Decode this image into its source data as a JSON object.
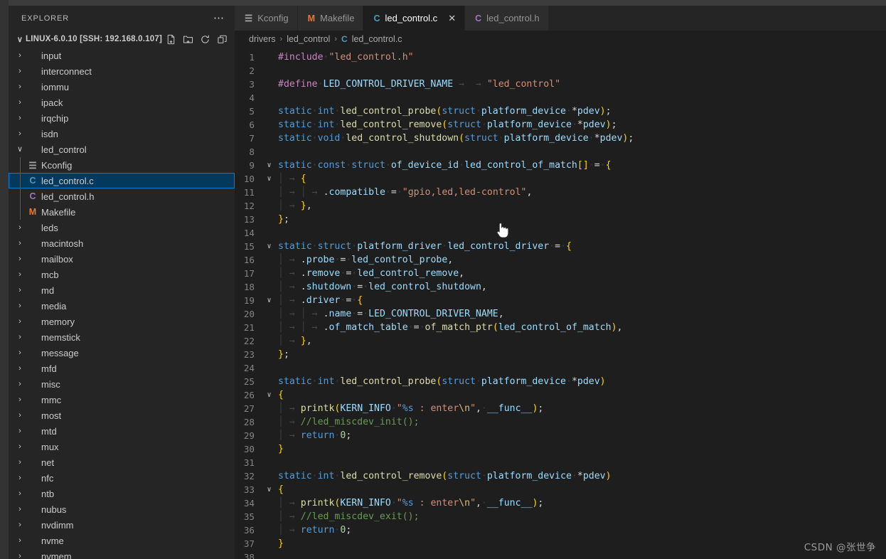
{
  "window": {
    "titlebar_color": "#3c3c3c",
    "sidebar_color": "#252526",
    "editor_color": "#1e1e1e",
    "accent_color": "#007fd4",
    "selection_color": "#04395e"
  },
  "sidebar": {
    "title": "EXPLORER",
    "more_actions": "⋯",
    "root": {
      "chevron": "∨",
      "name": "LINUX-6.0.10 [SSH: 192.168.0.107]",
      "actions": [
        {
          "name": "new-file",
          "tooltip": "New File"
        },
        {
          "name": "new-folder",
          "tooltip": "New Folder"
        },
        {
          "name": "refresh-explorer",
          "tooltip": "Refresh Explorer"
        },
        {
          "name": "collapse-folders",
          "tooltip": "Collapse Folders in Explorer"
        }
      ]
    },
    "tree": [
      {
        "label": "input",
        "type": "folder",
        "expanded": false,
        "depth": 1,
        "arrow": "›"
      },
      {
        "label": "interconnect",
        "type": "folder",
        "expanded": false,
        "depth": 1,
        "arrow": "›"
      },
      {
        "label": "iommu",
        "type": "folder",
        "expanded": false,
        "depth": 1,
        "arrow": "›"
      },
      {
        "label": "ipack",
        "type": "folder",
        "expanded": false,
        "depth": 1,
        "arrow": "›"
      },
      {
        "label": "irqchip",
        "type": "folder",
        "expanded": false,
        "depth": 1,
        "arrow": "›"
      },
      {
        "label": "isdn",
        "type": "folder",
        "expanded": false,
        "depth": 1,
        "arrow": "›"
      },
      {
        "label": "led_control",
        "type": "folder",
        "expanded": true,
        "depth": 1,
        "arrow": "∨"
      },
      {
        "label": "Kconfig",
        "type": "file",
        "icon": "kconfig-icon",
        "glyph": "☰",
        "iconclass": "ic-k",
        "depth": 2,
        "selected": false
      },
      {
        "label": "led_control.c",
        "type": "file",
        "icon": "c-file-icon",
        "glyph": "C",
        "iconclass": "ic-c",
        "depth": 2,
        "selected": true
      },
      {
        "label": "led_control.h",
        "type": "file",
        "icon": "h-file-icon",
        "glyph": "C",
        "iconclass": "ic-h",
        "depth": 2,
        "selected": false
      },
      {
        "label": "Makefile",
        "type": "file",
        "icon": "makefile-icon",
        "glyph": "M",
        "iconclass": "ic-m",
        "depth": 2,
        "selected": false
      },
      {
        "label": "leds",
        "type": "folder",
        "expanded": false,
        "depth": 1,
        "arrow": "›"
      },
      {
        "label": "macintosh",
        "type": "folder",
        "expanded": false,
        "depth": 1,
        "arrow": "›"
      },
      {
        "label": "mailbox",
        "type": "folder",
        "expanded": false,
        "depth": 1,
        "arrow": "›"
      },
      {
        "label": "mcb",
        "type": "folder",
        "expanded": false,
        "depth": 1,
        "arrow": "›"
      },
      {
        "label": "md",
        "type": "folder",
        "expanded": false,
        "depth": 1,
        "arrow": "›"
      },
      {
        "label": "media",
        "type": "folder",
        "expanded": false,
        "depth": 1,
        "arrow": "›"
      },
      {
        "label": "memory",
        "type": "folder",
        "expanded": false,
        "depth": 1,
        "arrow": "›"
      },
      {
        "label": "memstick",
        "type": "folder",
        "expanded": false,
        "depth": 1,
        "arrow": "›"
      },
      {
        "label": "message",
        "type": "folder",
        "expanded": false,
        "depth": 1,
        "arrow": "›"
      },
      {
        "label": "mfd",
        "type": "folder",
        "expanded": false,
        "depth": 1,
        "arrow": "›"
      },
      {
        "label": "misc",
        "type": "folder",
        "expanded": false,
        "depth": 1,
        "arrow": "›"
      },
      {
        "label": "mmc",
        "type": "folder",
        "expanded": false,
        "depth": 1,
        "arrow": "›"
      },
      {
        "label": "most",
        "type": "folder",
        "expanded": false,
        "depth": 1,
        "arrow": "›"
      },
      {
        "label": "mtd",
        "type": "folder",
        "expanded": false,
        "depth": 1,
        "arrow": "›"
      },
      {
        "label": "mux",
        "type": "folder",
        "expanded": false,
        "depth": 1,
        "arrow": "›"
      },
      {
        "label": "net",
        "type": "folder",
        "expanded": false,
        "depth": 1,
        "arrow": "›"
      },
      {
        "label": "nfc",
        "type": "folder",
        "expanded": false,
        "depth": 1,
        "arrow": "›"
      },
      {
        "label": "ntb",
        "type": "folder",
        "expanded": false,
        "depth": 1,
        "arrow": "›"
      },
      {
        "label": "nubus",
        "type": "folder",
        "expanded": false,
        "depth": 1,
        "arrow": "›"
      },
      {
        "label": "nvdimm",
        "type": "folder",
        "expanded": false,
        "depth": 1,
        "arrow": "›"
      },
      {
        "label": "nvme",
        "type": "folder",
        "expanded": false,
        "depth": 1,
        "arrow": "›"
      },
      {
        "label": "nvmem",
        "type": "folder",
        "expanded": false,
        "depth": 1,
        "arrow": "›"
      }
    ]
  },
  "tabs": [
    {
      "label": "Kconfig",
      "icon": "kconfig-icon",
      "glyph": "☰",
      "iconclass": "ic-k",
      "active": false,
      "closable": false
    },
    {
      "label": "Makefile",
      "icon": "makefile-icon",
      "glyph": "M",
      "iconclass": "ic-m",
      "active": false,
      "closable": false
    },
    {
      "label": "led_control.c",
      "icon": "c-file-icon",
      "glyph": "C",
      "iconclass": "ic-c",
      "active": true,
      "closable": true,
      "close_glyph": "✕"
    },
    {
      "label": "led_control.h",
      "icon": "h-file-icon",
      "glyph": "C",
      "iconclass": "ic-h",
      "active": false,
      "closable": false
    }
  ],
  "breadcrumb": {
    "items": [
      "drivers",
      "led_control",
      "led_control.c"
    ],
    "separator": "›",
    "file_icon_glyph": "C"
  },
  "editor": {
    "language": "c",
    "first_line": 1,
    "last_line": 38,
    "lines": [
      {
        "n": 1,
        "fold": "",
        "text": "#include \"led_control.h\""
      },
      {
        "n": 2,
        "fold": "",
        "text": ""
      },
      {
        "n": 3,
        "fold": "",
        "text": "#define LED_CONTROL_DRIVER_NAME\t\t\"led_control\""
      },
      {
        "n": 4,
        "fold": "",
        "text": ""
      },
      {
        "n": 5,
        "fold": "",
        "text": "static int led_control_probe(struct platform_device *pdev);"
      },
      {
        "n": 6,
        "fold": "",
        "text": "static int led_control_remove(struct platform_device *pdev);"
      },
      {
        "n": 7,
        "fold": "",
        "text": "static void led_control_shutdown(struct platform_device *pdev);"
      },
      {
        "n": 8,
        "fold": "",
        "text": ""
      },
      {
        "n": 9,
        "fold": "v",
        "text": "static const struct of_device_id led_control_of_match[] = {"
      },
      {
        "n": 10,
        "fold": "v",
        "text": "\t{"
      },
      {
        "n": 11,
        "fold": "",
        "text": "\t\t.compatible = \"gpio,led,led-control\","
      },
      {
        "n": 12,
        "fold": "",
        "text": "\t},"
      },
      {
        "n": 13,
        "fold": "",
        "text": "};"
      },
      {
        "n": 14,
        "fold": "",
        "text": ""
      },
      {
        "n": 15,
        "fold": "v",
        "text": "static struct platform_driver led_control_driver = {"
      },
      {
        "n": 16,
        "fold": "",
        "text": "\t.probe = led_control_probe,"
      },
      {
        "n": 17,
        "fold": "",
        "text": "\t.remove = led_control_remove,"
      },
      {
        "n": 18,
        "fold": "",
        "text": "\t.shutdown = led_control_shutdown,"
      },
      {
        "n": 19,
        "fold": "v",
        "text": "\t.driver = {"
      },
      {
        "n": 20,
        "fold": "",
        "text": "\t\t.name = LED_CONTROL_DRIVER_NAME,"
      },
      {
        "n": 21,
        "fold": "",
        "text": "\t\t.of_match_table = of_match_ptr(led_control_of_match),"
      },
      {
        "n": 22,
        "fold": "",
        "text": "\t},"
      },
      {
        "n": 23,
        "fold": "",
        "text": "};"
      },
      {
        "n": 24,
        "fold": "",
        "text": ""
      },
      {
        "n": 25,
        "fold": "",
        "text": "static int led_control_probe(struct platform_device *pdev)"
      },
      {
        "n": 26,
        "fold": "v",
        "text": "{"
      },
      {
        "n": 27,
        "fold": "",
        "text": "\tprintk(KERN_INFO \"%s : enter\\n\", __func__);"
      },
      {
        "n": 28,
        "fold": "",
        "text": "\t//led_miscdev_init();"
      },
      {
        "n": 29,
        "fold": "",
        "text": "\treturn 0;"
      },
      {
        "n": 30,
        "fold": "",
        "text": "}"
      },
      {
        "n": 31,
        "fold": "",
        "text": ""
      },
      {
        "n": 32,
        "fold": "",
        "text": "static int led_control_remove(struct platform_device *pdev)"
      },
      {
        "n": 33,
        "fold": "v",
        "text": "{"
      },
      {
        "n": 34,
        "fold": "",
        "text": "\tprintk(KERN_INFO \"%s : enter\\n\", __func__);"
      },
      {
        "n": 35,
        "fold": "",
        "text": "\t//led_miscdev_exit();"
      },
      {
        "n": 36,
        "fold": "",
        "text": "\treturn 0;"
      },
      {
        "n": 37,
        "fold": "",
        "text": "}"
      },
      {
        "n": 38,
        "fold": "",
        "text": ""
      }
    ]
  },
  "watermark": {
    "text": "CSDN @张世争"
  }
}
